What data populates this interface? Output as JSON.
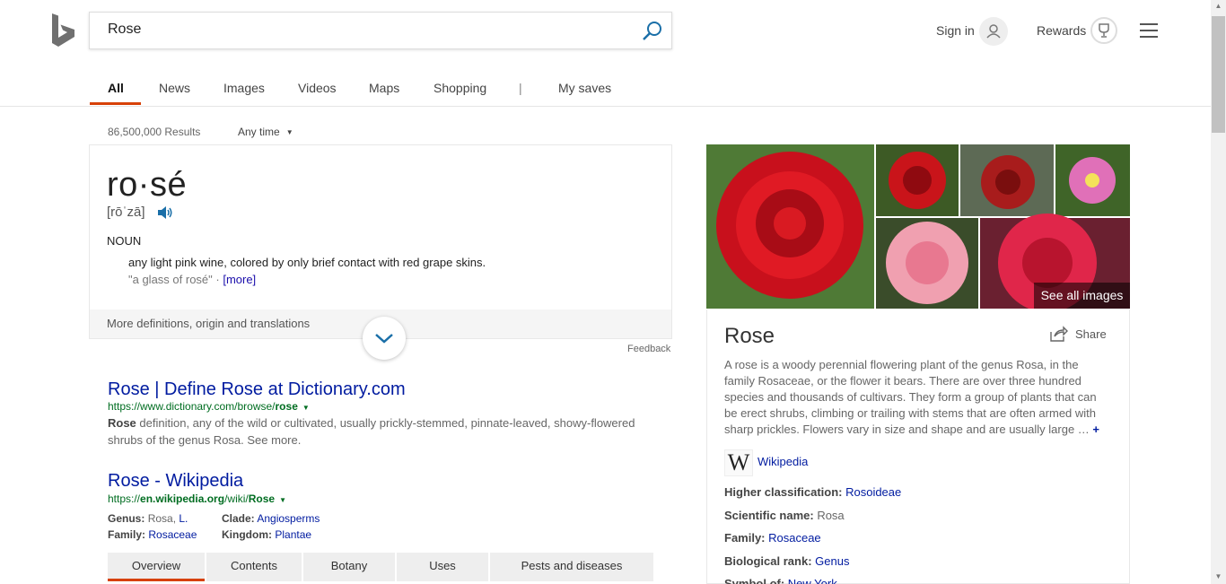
{
  "search": {
    "query": "Rose"
  },
  "header": {
    "sign_in": "Sign in",
    "rewards": "Rewards"
  },
  "tabs": [
    "All",
    "News",
    "Images",
    "Videos",
    "Maps",
    "Shopping",
    "|",
    "My saves"
  ],
  "meta": {
    "result_count": "86,500,000 Results",
    "time_filter": "Any time"
  },
  "dictionary": {
    "word": "ro·sé",
    "pronunciation": "[rōˈzā]",
    "part_of_speech": "NOUN",
    "definition": "any light pink wine, colored by only brief contact with red grape skins.",
    "example": "\"a glass of rosé\" · ",
    "more": "[more]",
    "more_definitions": "More definitions, origin and translations",
    "feedback": "Feedback"
  },
  "results": [
    {
      "title": "Rose | Define Rose at Dictionary.com",
      "url_prefix": "https://www.dictionary.com/browse/",
      "url_bold": "rose",
      "snippet_bold": "Rose",
      "snippet": " definition, any of the wild or cultivated, usually prickly-stemmed, pinnate-leaved, showy-flowered shrubs of the genus Rosa. See more."
    },
    {
      "title": "Rose - Wikipedia",
      "url_prefix": "https://",
      "url_bold1": "en.wikipedia.org",
      "url_mid": "/wiki/",
      "url_bold2": "Rose",
      "facts": {
        "genus_label": "Genus:",
        "genus_value": "Rosa, ",
        "genus_link": "L.",
        "family_label": "Family:",
        "family_link": "Rosaceae",
        "clade_label": "Clade:",
        "clade_link": "Angiosperms",
        "kingdom_label": "Kingdom:",
        "kingdom_link": "Plantae"
      },
      "tabs": [
        "Overview",
        "Contents",
        "Botany",
        "Uses",
        "Pests and diseases"
      ]
    }
  ],
  "knowledge": {
    "see_all": "See all images",
    "title": "Rose",
    "share": "Share",
    "description": "A rose is a woody perennial flowering plant of the genus Rosa, in the family Rosaceae, or the flower it bears. There are over three hundred species and thousands of cultivars. They form a group of plants that can be erect shrubs, climbing or trailing with stems that are often armed with sharp prickles. Flowers vary in size and shape and are usually large … ",
    "plus": "+",
    "wiki_logo": "W",
    "wiki_link": "Wikipedia",
    "facts": [
      {
        "label": "Higher classification: ",
        "value": "Rosoideae",
        "link": true
      },
      {
        "label": "Scientific name: ",
        "value": "Rosa",
        "link": false
      },
      {
        "label": "Family: ",
        "value": "Rosaceae",
        "link": true
      },
      {
        "label": "Biological rank: ",
        "value": "Genus",
        "link": true
      },
      {
        "label": "Symbol of: ",
        "value": "New York",
        "link": true
      }
    ]
  }
}
